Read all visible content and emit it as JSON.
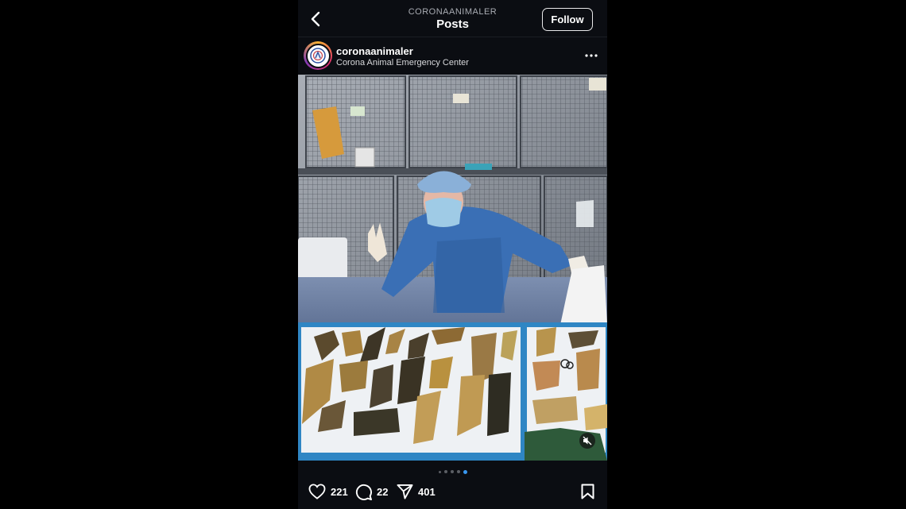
{
  "header": {
    "account_caps": "CORONAANIMALER",
    "title": "Posts",
    "follow_label": "Follow"
  },
  "post": {
    "username": "coronaanimaler",
    "location": "Corona Animal Emergency Center",
    "likes": "221",
    "comments": "22",
    "shares": "401",
    "carousel_total": 5,
    "carousel_active": 5
  },
  "icons": {
    "back": "chevron-left-icon",
    "more": "more-horizontal-icon",
    "mute": "muted-speaker-icon",
    "like": "heart-icon",
    "comment": "comment-icon",
    "share": "paper-plane-icon",
    "save": "bookmark-icon"
  },
  "colors": {
    "background": "#0b0d12",
    "accent_dot": "#3897f0",
    "scrub_blue": "#3a6fb5"
  }
}
